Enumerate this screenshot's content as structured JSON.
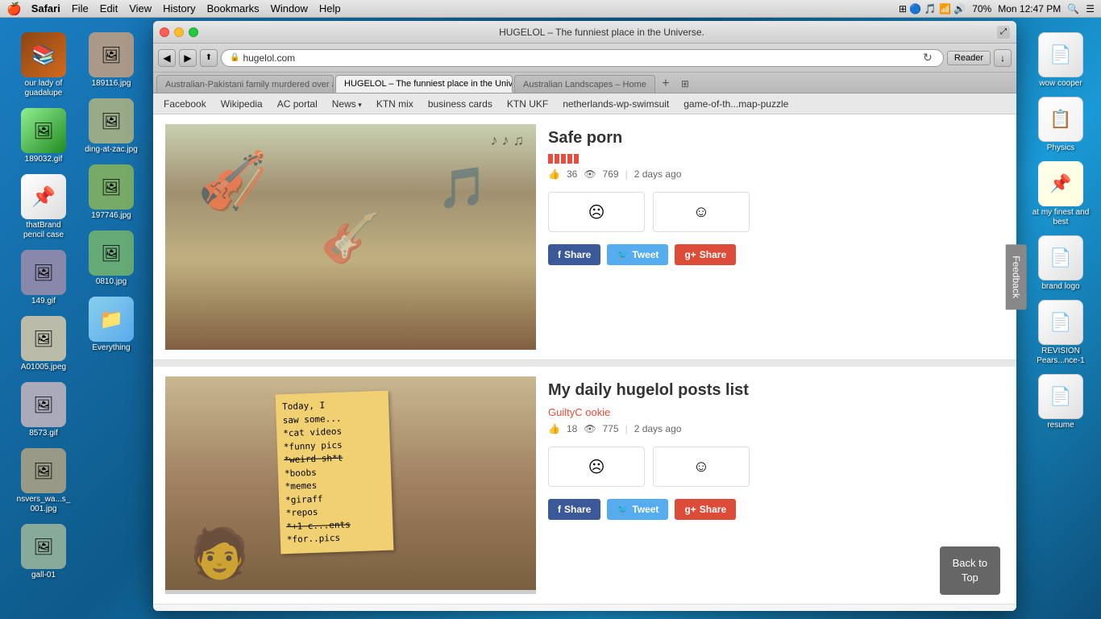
{
  "menubar": {
    "apple": "🍎",
    "items": [
      "Safari",
      "File",
      "Edit",
      "View",
      "History",
      "Bookmarks",
      "Window",
      "Help"
    ],
    "right": {
      "time": "Mon 12:47 PM",
      "battery": "70%"
    }
  },
  "browser": {
    "title": "HUGELOL – The funniest place in the Universe.",
    "address": "hugelol.com",
    "reader_label": "Reader",
    "tabs": [
      {
        "label": "Australian-Pakistani family murdered over al...",
        "active": false
      },
      {
        "label": "HUGELOL – The funniest place in the Universe.",
        "active": true
      },
      {
        "label": "Australian Landscapes – Home",
        "active": false
      }
    ],
    "bookmarks": [
      {
        "label": "Facebook",
        "arrow": false
      },
      {
        "label": "Wikipedia",
        "arrow": false
      },
      {
        "label": "AC portal",
        "arrow": false
      },
      {
        "label": "News",
        "arrow": true
      },
      {
        "label": "KTN mix",
        "arrow": false
      },
      {
        "label": "business cards",
        "arrow": false
      },
      {
        "label": "KTN UKF",
        "arrow": false
      },
      {
        "label": "netherlands-wp-swimsuit",
        "arrow": false
      },
      {
        "label": "game-of-th...map-puzzle",
        "arrow": false
      }
    ]
  },
  "posts": [
    {
      "title": "Safe porn",
      "user": "user bars",
      "votes": "36",
      "views": "769",
      "time": "2 days ago",
      "share_fb": "Share",
      "share_tw": "Tweet",
      "share_g": "Share"
    },
    {
      "title": "My daily hugelol posts list",
      "user": "GuiltyC ookie",
      "votes": "18",
      "views": "775",
      "time": "2 days ago",
      "share_fb": "Share",
      "share_tw": "Tweet",
      "share_g": "Share",
      "note_lines": [
        "Today, I",
        "saw some...",
        "*cat videos",
        "*funny pics",
        "*weird shit",
        "*boobs",
        "*memes",
        "*giraff",
        "*repos",
        "*+1 comments",
        "*for pics"
      ]
    }
  ],
  "feedback_label": "Feedback",
  "back_to_top": {
    "line1": "Back to",
    "line2": "Top"
  },
  "desktop_icons_right": [
    {
      "label": "wow cooper",
      "emoji": "📄"
    },
    {
      "label": "Physics",
      "emoji": "📋"
    },
    {
      "label": "at my finest and best",
      "emoji": "📌"
    },
    {
      "label": "brand logo",
      "emoji": "📄"
    },
    {
      "label": "REVISION Pears...nce-1",
      "emoji": "📄"
    },
    {
      "label": "resume",
      "emoji": "📄"
    }
  ],
  "desktop_icons_left": [
    {
      "label": "our lady of guadalupe",
      "emoji": "📚"
    },
    {
      "label": "189032.gif",
      "emoji": "🖼"
    },
    {
      "label": "thatBrand pencil case",
      "emoji": "📌"
    },
    {
      "label": "149.gif",
      "emoji": "🖼"
    },
    {
      "label": "A01005.jpeg",
      "emoji": "🖼"
    },
    {
      "label": "8573.gif",
      "emoji": "🖼"
    },
    {
      "label": "nsvers_wa...s_001.jpg",
      "emoji": "🖼"
    },
    {
      "label": "gall-01",
      "emoji": "🖼"
    },
    {
      "label": "189116.jpg",
      "emoji": "🖼"
    },
    {
      "label": "ding-at-zac.jpg",
      "emoji": "🖼"
    },
    {
      "label": "197746.jpg",
      "emoji": "🖼"
    },
    {
      "label": "0810.jpg",
      "emoji": "🖼"
    },
    {
      "label": "Everything",
      "emoji": "📁"
    }
  ]
}
